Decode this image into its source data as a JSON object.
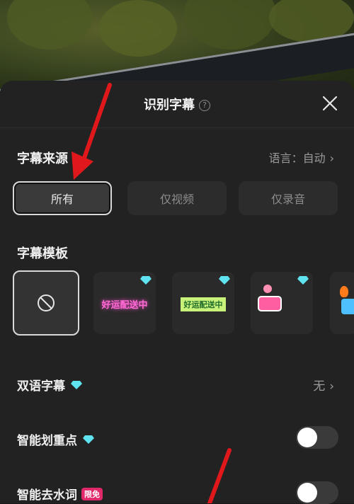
{
  "header": {
    "title": "识别字幕",
    "help_symbol": "?"
  },
  "source": {
    "label": "字幕来源",
    "language": "语言：自动",
    "options": [
      {
        "label": "所有",
        "selected": true
      },
      {
        "label": "仅视频",
        "selected": false
      },
      {
        "label": "仅录音",
        "selected": false
      }
    ]
  },
  "templates": {
    "label": "字幕模板",
    "items": [
      {
        "name": "none",
        "text": "",
        "selected": true
      },
      {
        "name": "template-1",
        "text": "好运配送中",
        "premium": true
      },
      {
        "name": "template-2",
        "text": "好运配送中",
        "premium": true
      },
      {
        "name": "template-3",
        "text": "",
        "premium": true
      },
      {
        "name": "template-4",
        "text": "",
        "premium": false
      }
    ]
  },
  "bilingual": {
    "label": "双语字幕",
    "value": "无"
  },
  "highlight": {
    "label": "智能划重点",
    "enabled": false
  },
  "filler": {
    "label": "智能去水词",
    "badge": "限免",
    "enabled": false
  },
  "colors": {
    "accent_pink": "#e0286a",
    "arrow_red": "#e0181b",
    "gem_cyan": "#5fe3f0"
  }
}
